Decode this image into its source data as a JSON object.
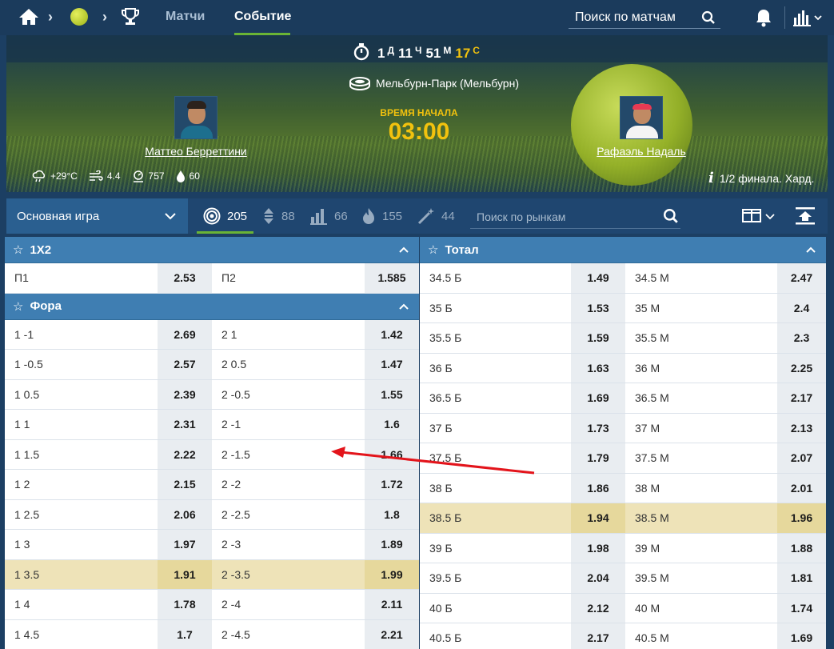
{
  "nav": {
    "matches_label": "Матчи",
    "event_label": "Событие",
    "search_placeholder": "Поиск по матчам"
  },
  "banner": {
    "countdown": {
      "d": "1",
      "d_unit": "Д",
      "h": "11",
      "h_unit": "Ч",
      "m": "51",
      "m_unit": "М",
      "s": "17",
      "s_unit": "С"
    },
    "venue": "Мельбурн-Парк (Мельбурн)",
    "start_label": "ВРЕМЯ НАЧАЛА",
    "start_time": "03:00",
    "player1": "Маттео Берреттини",
    "player2": "Рафаэль Надаль",
    "weather": {
      "temp": "+29°C",
      "wind": "4.4",
      "pressure": "757",
      "humidity": "60"
    },
    "round": "1/2 финала. Хард."
  },
  "toolbar": {
    "market_select": "Основная игра",
    "counts": {
      "all": "205",
      "totals": "88",
      "handicaps": "66",
      "hot": "155",
      "specials": "44"
    },
    "market_search_placeholder": "Поиск по рынкам"
  },
  "markets": {
    "x12": {
      "title": "1X2",
      "rows": [
        {
          "l1": "П1",
          "o1": "2.53",
          "l2": "П2",
          "o2": "1.585"
        }
      ]
    },
    "handicap": {
      "title": "Фора",
      "rows": [
        {
          "l1": "1 -1",
          "o1": "2.69",
          "l2": "2 1",
          "o2": "1.42"
        },
        {
          "l1": "1 -0.5",
          "o1": "2.57",
          "l2": "2 0.5",
          "o2": "1.47"
        },
        {
          "l1": "1 0.5",
          "o1": "2.39",
          "l2": "2 -0.5",
          "o2": "1.55"
        },
        {
          "l1": "1 1",
          "o1": "2.31",
          "l2": "2 -1",
          "o2": "1.6"
        },
        {
          "l1": "1 1.5",
          "o1": "2.22",
          "l2": "2 -1.5",
          "o2": "1.66"
        },
        {
          "l1": "1 2",
          "o1": "2.15",
          "l2": "2 -2",
          "o2": "1.72"
        },
        {
          "l1": "1 2.5",
          "o1": "2.06",
          "l2": "2 -2.5",
          "o2": "1.8"
        },
        {
          "l1": "1 3",
          "o1": "1.97",
          "l2": "2 -3",
          "o2": "1.89"
        },
        {
          "l1": "1 3.5",
          "o1": "1.91",
          "l2": "2 -3.5",
          "o2": "1.99"
        },
        {
          "l1": "1 4",
          "o1": "1.78",
          "l2": "2 -4",
          "o2": "2.11"
        },
        {
          "l1": "1 4.5",
          "o1": "1.7",
          "l2": "2 -4.5",
          "o2": "2.21"
        }
      ]
    },
    "total": {
      "title": "Тотал",
      "rows": [
        {
          "l1": "34.5 Б",
          "o1": "1.49",
          "l2": "34.5 М",
          "o2": "2.47"
        },
        {
          "l1": "35 Б",
          "o1": "1.53",
          "l2": "35 М",
          "o2": "2.4"
        },
        {
          "l1": "35.5 Б",
          "o1": "1.59",
          "l2": "35.5 М",
          "o2": "2.3"
        },
        {
          "l1": "36 Б",
          "o1": "1.63",
          "l2": "36 М",
          "o2": "2.25"
        },
        {
          "l1": "36.5 Б",
          "o1": "1.69",
          "l2": "36.5 М",
          "o2": "2.17"
        },
        {
          "l1": "37 Б",
          "o1": "1.73",
          "l2": "37 М",
          "o2": "2.13"
        },
        {
          "l1": "37.5 Б",
          "o1": "1.79",
          "l2": "37.5 М",
          "o2": "2.07"
        },
        {
          "l1": "38 Б",
          "o1": "1.86",
          "l2": "38 М",
          "o2": "2.01"
        },
        {
          "l1": "38.5 Б",
          "o1": "1.94",
          "l2": "38.5 М",
          "o2": "1.96"
        },
        {
          "l1": "39 Б",
          "o1": "1.98",
          "l2": "39 М",
          "o2": "1.88"
        },
        {
          "l1": "39.5 Б",
          "o1": "2.04",
          "l2": "39.5 М",
          "o2": "1.81"
        },
        {
          "l1": "40 Б",
          "o1": "2.12",
          "l2": "40 М",
          "o2": "1.74"
        },
        {
          "l1": "40.5 Б",
          "o1": "2.17",
          "l2": "40.5 М",
          "o2": "1.69"
        }
      ]
    }
  },
  "colors": {
    "accent_green": "#6ab435",
    "gold": "#f2c20e",
    "highlight_row": "#eee3b8",
    "arrow": "#e3141b"
  }
}
